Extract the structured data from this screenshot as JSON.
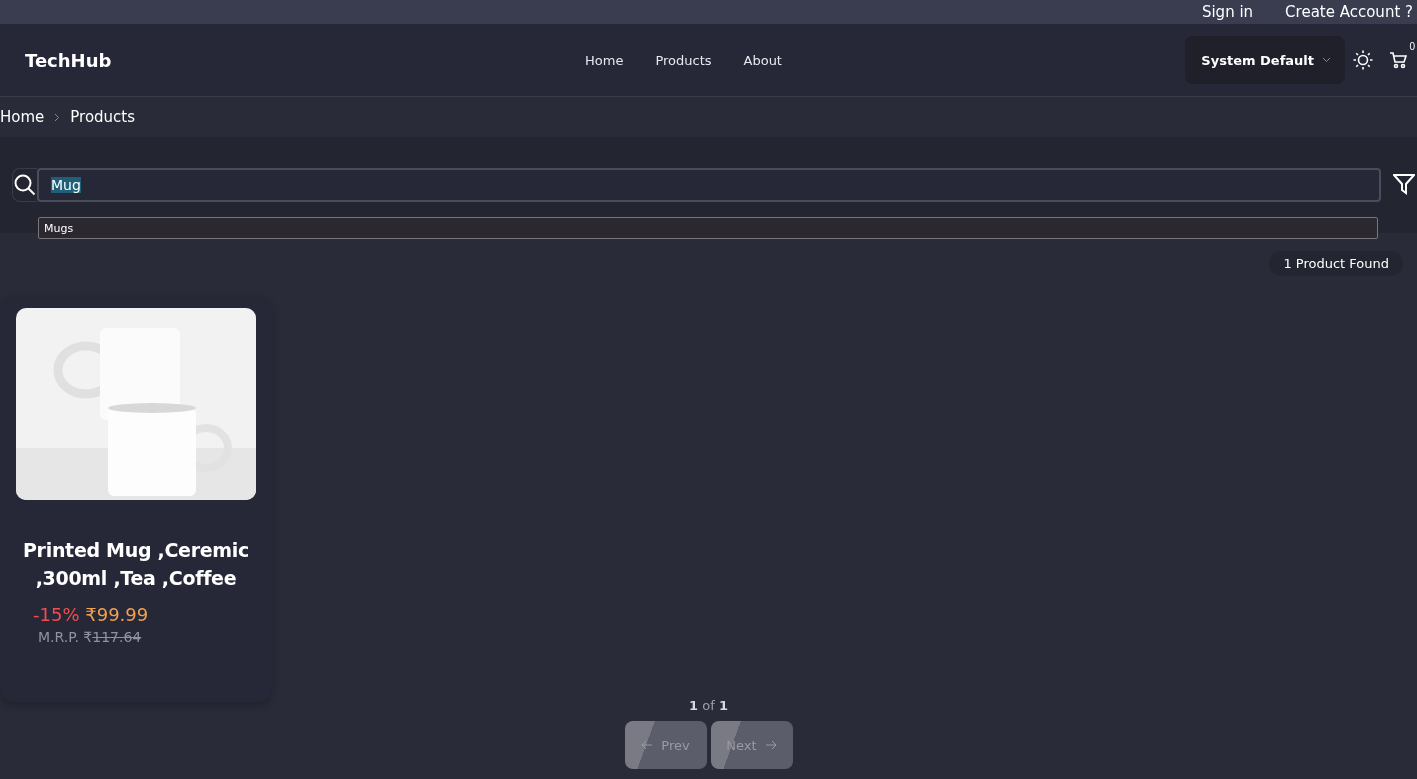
{
  "top_bar": {
    "links": [
      "Sign in",
      "Create Account ?"
    ]
  },
  "header": {
    "logo": "TechHub",
    "nav": [
      "Home",
      "Products",
      "About"
    ],
    "theme_select": "System Default",
    "cart_count": "0"
  },
  "breadcrumb": [
    "Home",
    "Products"
  ],
  "search": {
    "value": "Mug",
    "suggestions": [
      "Mugs"
    ]
  },
  "result_count": "1 Product Found",
  "products": [
    {
      "kind": "picture",
      "title": "Printed Mug ,Ceremic ,300ml ,Tea ,Coffee",
      "discount": "-15%",
      "price": "₹99.99",
      "mrp_label": "M.R.P. ₹",
      "mrp_value": "117.64"
    }
  ],
  "pagination": {
    "text": "**1** of **1**",
    "prev": "Prev",
    "next": "Next",
    "disabled": true
  }
}
